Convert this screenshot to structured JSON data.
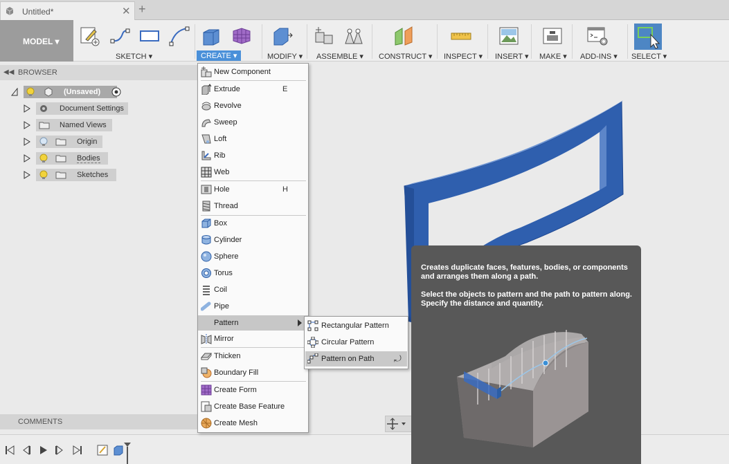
{
  "tab": {
    "title": "Untitled*",
    "close": "✕",
    "new": "+"
  },
  "workspace": {
    "label": "MODEL ▾"
  },
  "toolbar": {
    "groups": [
      {
        "label": "SKETCH ▾"
      },
      {
        "label": "CREATE ▾"
      },
      {
        "label": "MODIFY ▾"
      },
      {
        "label": "ASSEMBLE ▾"
      },
      {
        "label": "CONSTRUCT ▾"
      },
      {
        "label": "INSPECT ▾"
      },
      {
        "label": "INSERT ▾"
      },
      {
        "label": "MAKE ▾"
      },
      {
        "label": "ADD-INS ▾"
      },
      {
        "label": "SELECT ▾"
      }
    ],
    "accent": "#4a90d9"
  },
  "browser": {
    "title": "BROWSER",
    "root": "(Unsaved)",
    "items": [
      {
        "label": "Document Settings"
      },
      {
        "label": "Named Views"
      },
      {
        "label": "Origin"
      },
      {
        "label": "Bodies"
      },
      {
        "label": "Sketches"
      }
    ]
  },
  "comments": {
    "title": "COMMENTS"
  },
  "create_menu": {
    "items": [
      {
        "label": "New Component",
        "icon": "component-icon"
      },
      {
        "label": "Extrude",
        "shortcut": "E",
        "icon": "extrude-icon"
      },
      {
        "label": "Revolve",
        "icon": "revolve-icon"
      },
      {
        "label": "Sweep",
        "icon": "sweep-icon"
      },
      {
        "label": "Loft",
        "icon": "loft-icon"
      },
      {
        "label": "Rib",
        "icon": "rib-icon"
      },
      {
        "label": "Web",
        "icon": "web-icon"
      },
      {
        "label": "Hole",
        "shortcut": "H",
        "icon": "hole-icon"
      },
      {
        "label": "Thread",
        "icon": "thread-icon"
      },
      {
        "label": "Box",
        "icon": "box-icon"
      },
      {
        "label": "Cylinder",
        "icon": "cylinder-icon"
      },
      {
        "label": "Sphere",
        "icon": "sphere-icon"
      },
      {
        "label": "Torus",
        "icon": "torus-icon"
      },
      {
        "label": "Coil",
        "icon": "coil-icon"
      },
      {
        "label": "Pipe",
        "icon": "pipe-icon"
      },
      {
        "label": "Pattern",
        "icon": ""
      },
      {
        "label": "Mirror",
        "icon": "mirror-icon"
      },
      {
        "label": "Thicken",
        "icon": "thicken-icon"
      },
      {
        "label": "Boundary Fill",
        "icon": "boundary-fill-icon"
      },
      {
        "label": "Create Form",
        "icon": "create-form-icon"
      },
      {
        "label": "Create Base Feature",
        "icon": "base-feature-icon"
      },
      {
        "label": "Create Mesh",
        "icon": "create-mesh-icon"
      }
    ]
  },
  "pattern_submenu": {
    "items": [
      {
        "label": "Rectangular Pattern",
        "icon": "rectangular-pattern-icon"
      },
      {
        "label": "Circular Pattern",
        "icon": "circular-pattern-icon"
      },
      {
        "label": "Pattern on Path",
        "icon": "pattern-on-path-icon"
      }
    ],
    "repeat_glyph": "⤾"
  },
  "tooltip": {
    "line1": "Creates duplicate faces, features, bodies, or components and arranges them along a path.",
    "line2": "Select the objects to pattern and the path to pattern along. Specify the distance and quantity."
  },
  "colors": {
    "model_blue": "#2f5fae",
    "model_edge": "#1d4690",
    "tooltip_bg": "#585858"
  }
}
